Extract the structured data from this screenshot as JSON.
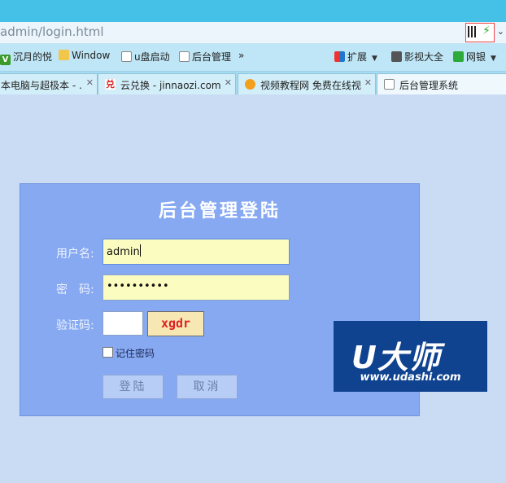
{
  "browser": {
    "address": "admin/login.html",
    "chevron": "⌄",
    "bookmarks": {
      "items": [
        {
          "label": "沉月的悦",
          "icon": "green-v-icon"
        },
        {
          "label": "Window",
          "icon": "folder-icon"
        },
        {
          "label": "u盘启动",
          "icon": "page-icon"
        },
        {
          "label": "后台管理",
          "icon": "page-icon"
        }
      ],
      "more": "»",
      "right": [
        {
          "label": "扩展",
          "icon": "extension-icon"
        },
        {
          "label": "影视大全",
          "icon": "video-icon"
        },
        {
          "label": "网银",
          "icon": "bank-icon"
        }
      ]
    },
    "tabs": [
      {
        "label": "本电脑与超极本 - ."
      },
      {
        "label": "云兑换 - jinnaozi.com"
      },
      {
        "label": "视频教程网 免费在线视"
      },
      {
        "label": "后台管理系统"
      }
    ]
  },
  "login": {
    "title": "后台管理登陆",
    "username_label": "用户名:",
    "username_value": "admin",
    "password_label": "密　码:",
    "password_value": "••••••••••",
    "captcha_label": "验证码:",
    "captcha_text": "xgdr",
    "remember_label": "记住密码",
    "login_button": "登陆",
    "cancel_button": "取消"
  },
  "watermark": {
    "logo": "U大师",
    "url": "www.udashi.com"
  },
  "colors": {
    "accent": "#45c0e6",
    "panel": "#87a9f2",
    "input_bg": "#fbfdc0"
  }
}
